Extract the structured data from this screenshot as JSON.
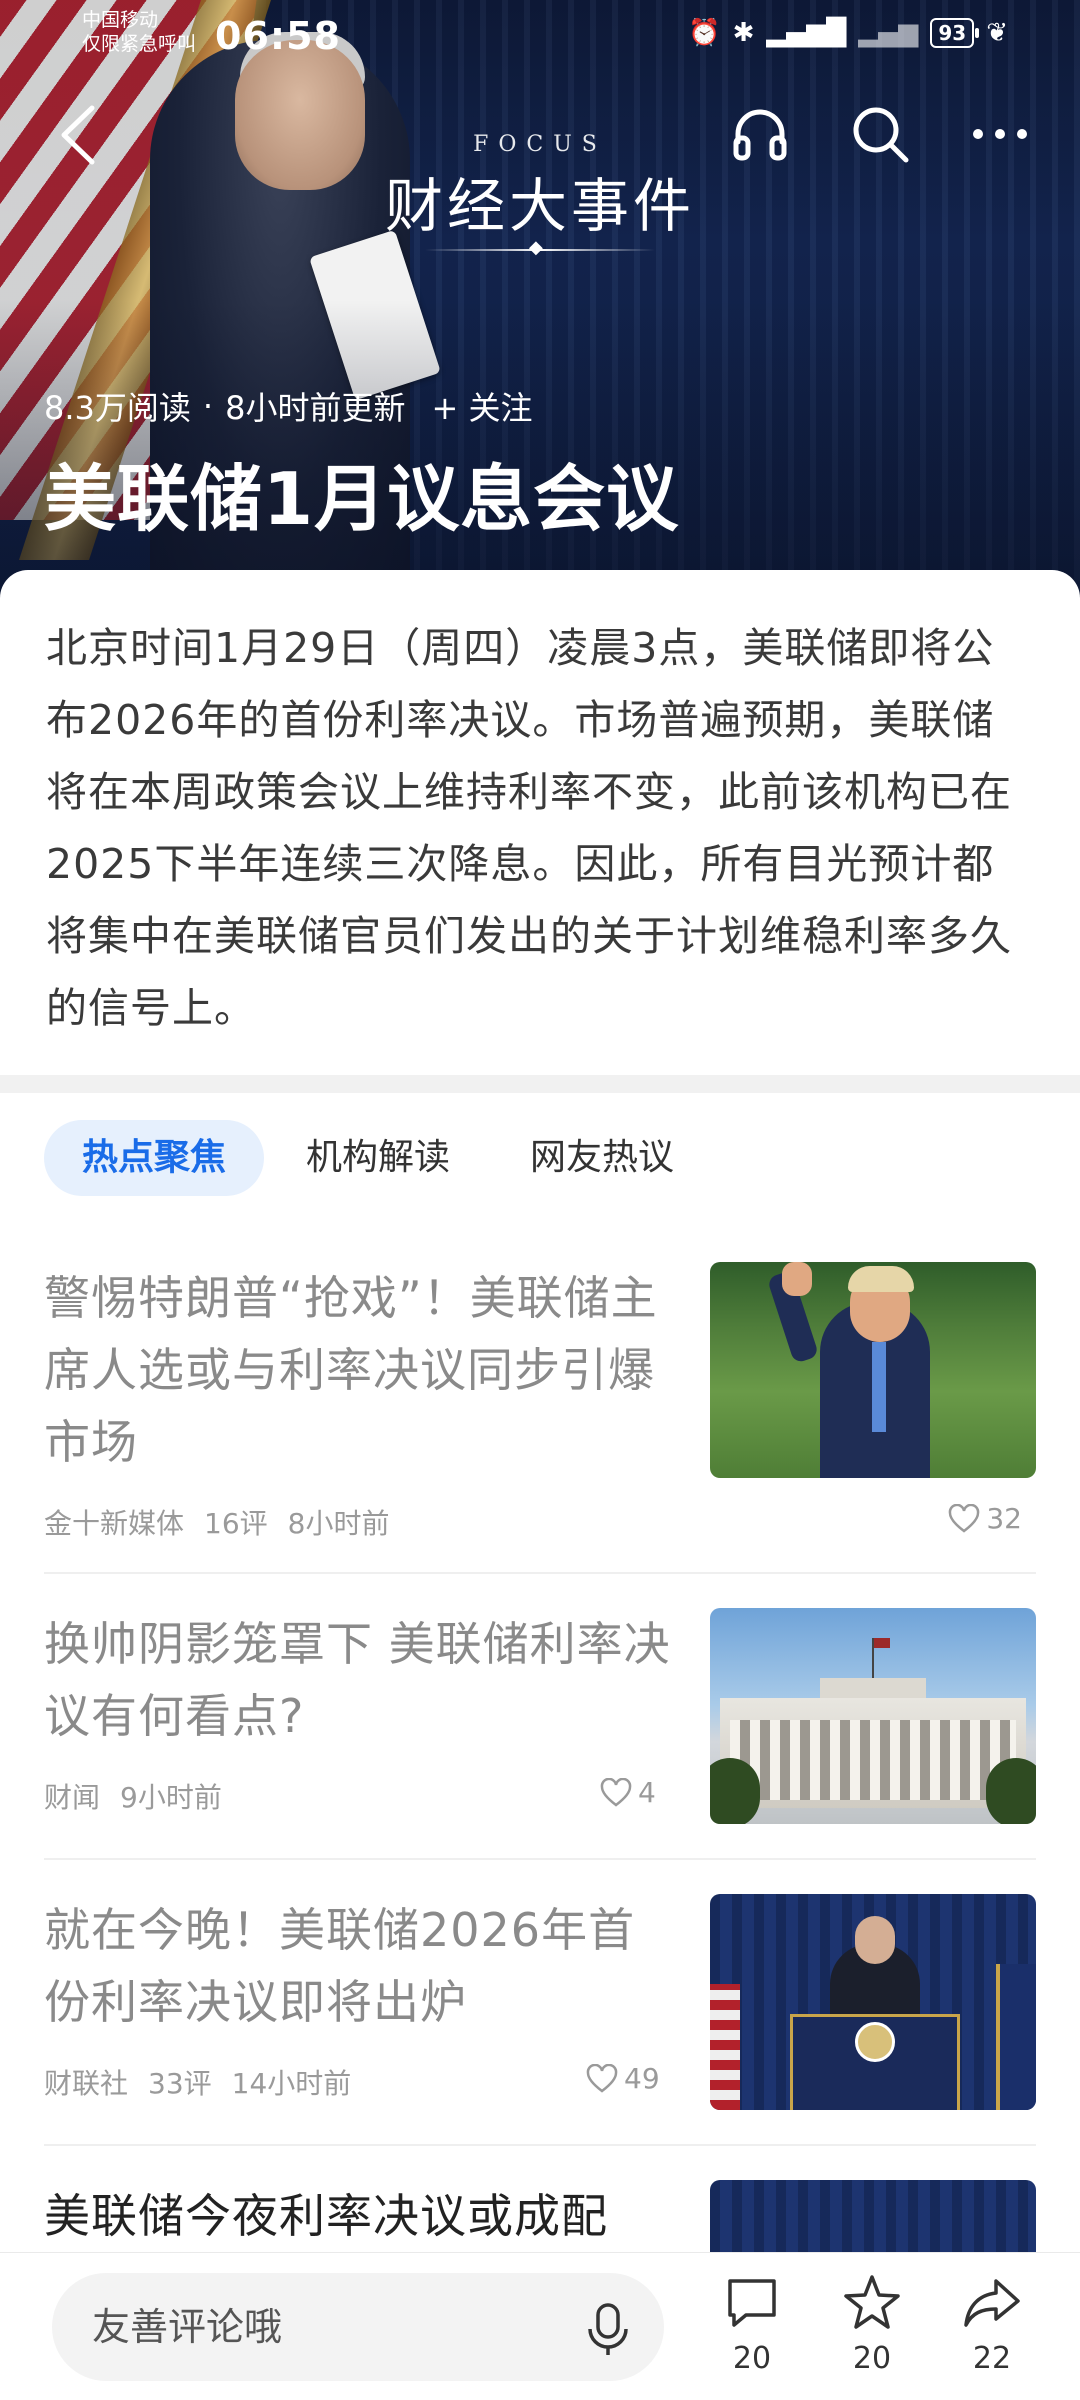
{
  "status_bar": {
    "carrier_line1": "中国移动",
    "carrier_line2": "仅限紧急呼叫",
    "time": "06:58",
    "battery": "93"
  },
  "header": {
    "focus_en": "FOCUS",
    "focus_cn": "财经大事件"
  },
  "topic": {
    "reads": "8.3万阅读",
    "updated": "8小时前更新",
    "follow_label": "+ 关注",
    "title": "美联储1月议息会议",
    "summary": "北京时间1月29日（周四）凌晨3点，美联储即将公布2026年的首份利率决议。市场普遍预期，美联储将在本周政策会议上维持利率不变，此前该机构已在2025下半年连续三次降息。因此，所有目光预计都将集中在美联储官员们发出的关于计划维稳利率多久的信号上。"
  },
  "tabs": [
    {
      "label": "热点聚焦"
    },
    {
      "label": "机构解读"
    },
    {
      "label": "网友热议"
    }
  ],
  "news": [
    {
      "title": "警惕特朗普“抢戏”！美联储主席人选或与利率决议同步引爆市场",
      "source": "金十新媒体",
      "comments": "16评",
      "time": "8小时前",
      "likes": "32"
    },
    {
      "title": "换帅阴影笼罩下 美联储利率决议有何看点?",
      "source": "财闻",
      "comments": "",
      "time": "9小时前",
      "likes": "4"
    },
    {
      "title": "就在今晚！美联储2026年首份利率决议即将出炉",
      "source": "财联社",
      "comments": "33评",
      "time": "14小时前",
      "likes": "49"
    },
    {
      "title": "美联储今夜利率决议或成配"
    }
  ],
  "bottom_bar": {
    "comment_placeholder": "友善评论哦",
    "comment_count": "20",
    "favorite_count": "20",
    "share_count": "22"
  },
  "colors": {
    "accent": "#1a6ce8",
    "tab_active_bg": "#e6f0fd",
    "hero_bg": "#132652"
  }
}
